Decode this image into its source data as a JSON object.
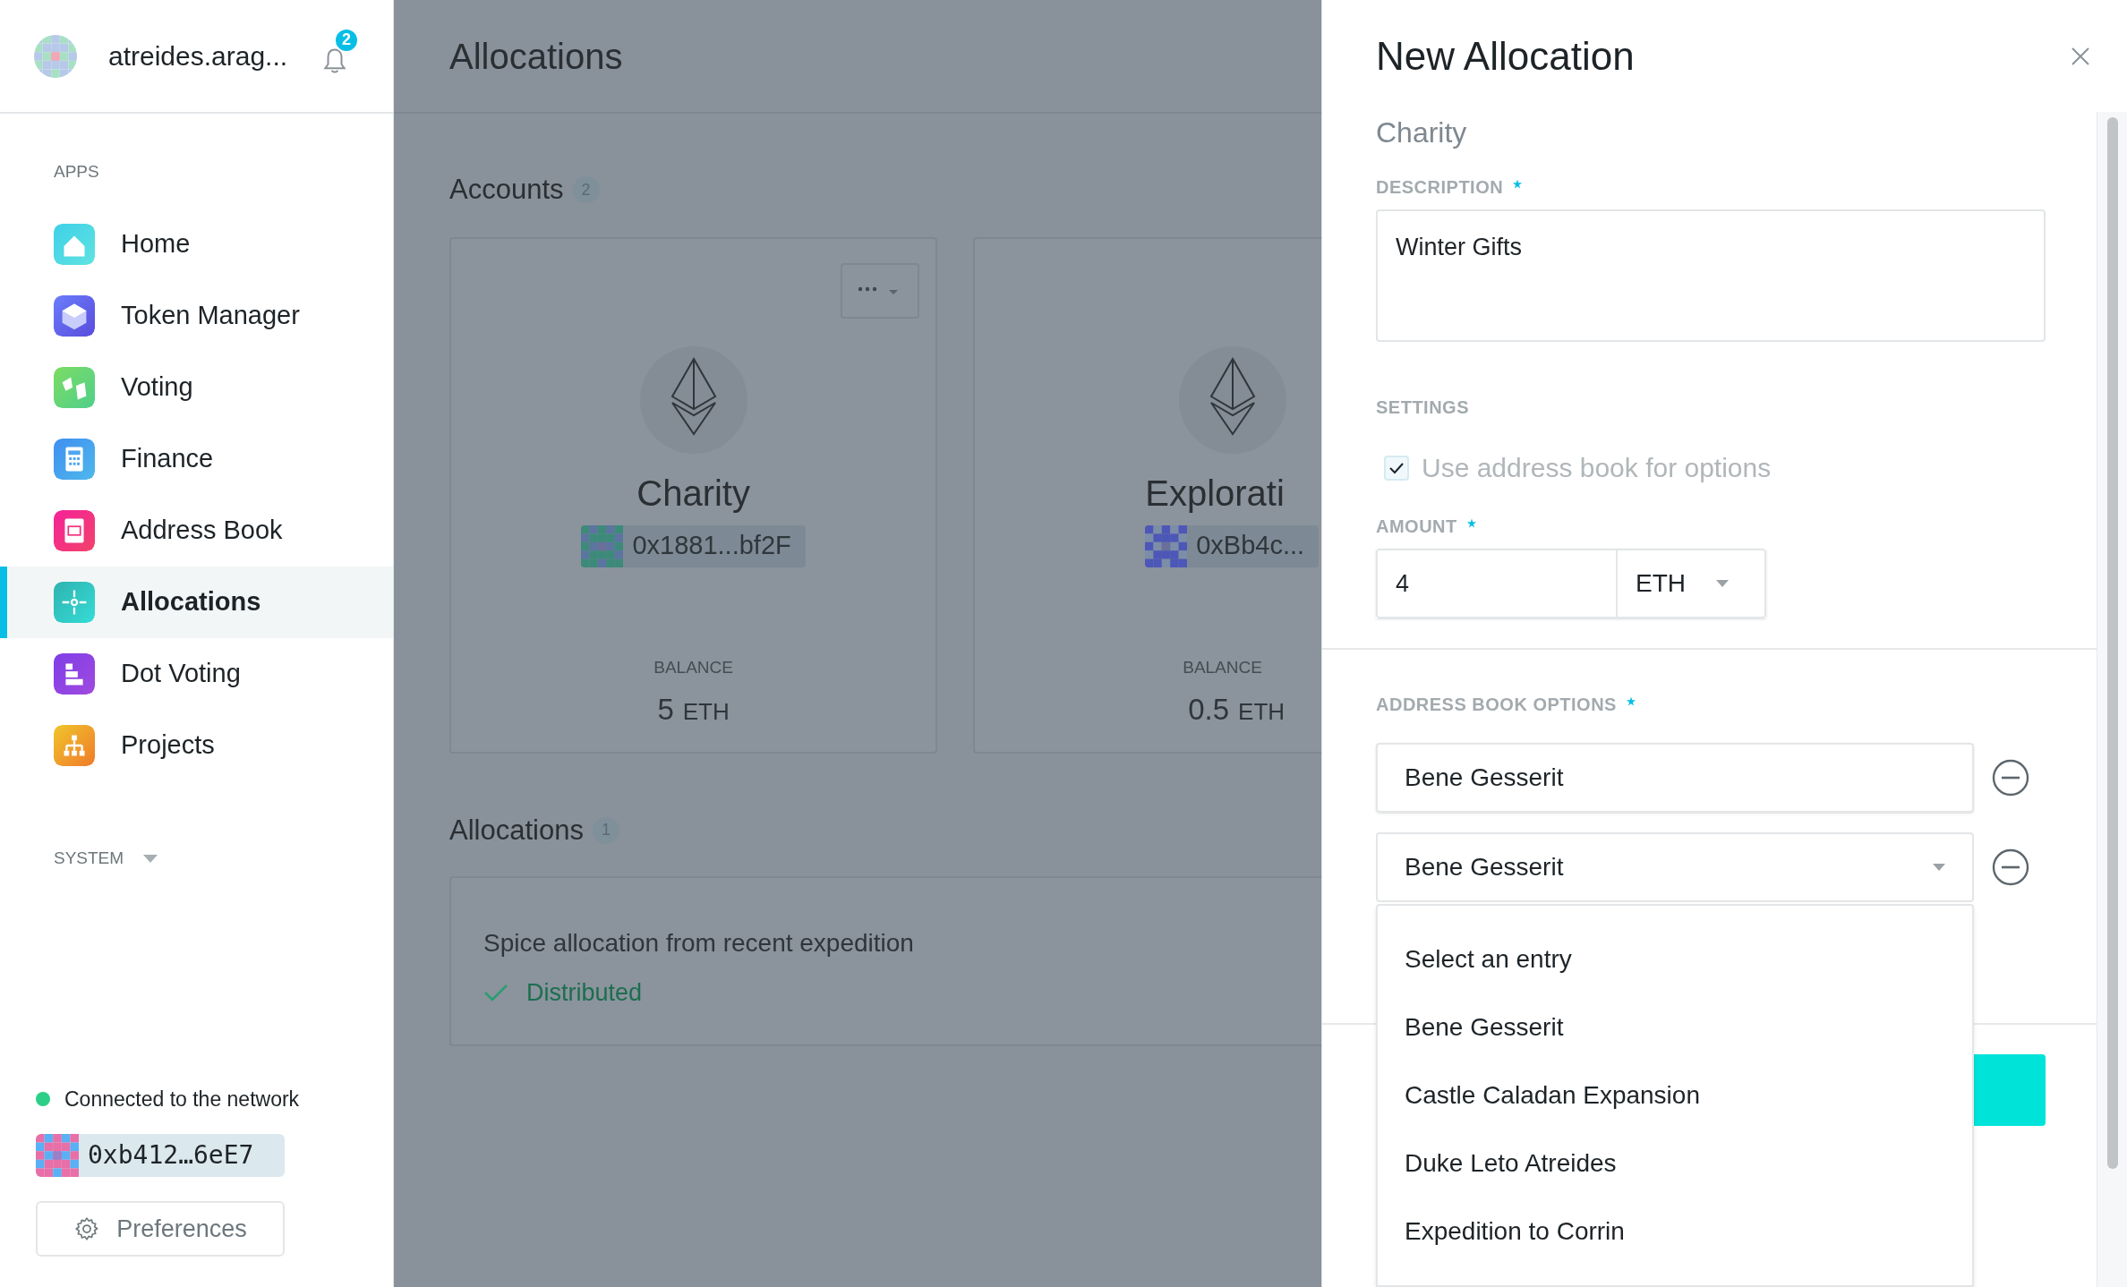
{
  "sidebar": {
    "account_name": "atreides.arag...",
    "notification_count": "2",
    "apps_heading": "APPS",
    "apps": [
      {
        "label": "Home",
        "kind": "home",
        "selected": false
      },
      {
        "label": "Token Manager",
        "kind": "token",
        "selected": false
      },
      {
        "label": "Voting",
        "kind": "voting",
        "selected": false
      },
      {
        "label": "Finance",
        "kind": "finance",
        "selected": false
      },
      {
        "label": "Address Book",
        "kind": "addressbook",
        "selected": false
      },
      {
        "label": "Allocations",
        "kind": "allocations",
        "selected": true
      },
      {
        "label": "Dot Voting",
        "kind": "dotvoting",
        "selected": false
      },
      {
        "label": "Projects",
        "kind": "projects",
        "selected": false
      }
    ],
    "system_heading": "SYSTEM",
    "network_status": "Connected to the network",
    "address": "0xb412…6eE7",
    "preferences_button": "Preferences"
  },
  "main": {
    "title": "Allocations",
    "accounts": {
      "heading": "Accounts",
      "count": "2",
      "cards": [
        {
          "name": "Charity",
          "address": "0x1881...bf2F",
          "balance_label": "BALANCE",
          "balance": "5",
          "unit": "ETH",
          "menu": true
        },
        {
          "name": "Explorati",
          "address": "0xBb4c...",
          "balance_label": "BALANCE",
          "balance": "0.5",
          "unit": "ETH",
          "menu": false
        }
      ]
    },
    "allocations": {
      "heading": "Allocations",
      "count": "1",
      "items": [
        {
          "description": "Spice allocation from recent expedition",
          "status": "Distributed"
        }
      ]
    }
  },
  "panel": {
    "title": "New Allocation",
    "subtitle": "Charity",
    "description": {
      "label": "DESCRIPTION",
      "required": true,
      "value": "Winter Gifts"
    },
    "settings": {
      "heading": "SETTINGS",
      "checkbox": {
        "label": "Use address book for options",
        "checked": true
      }
    },
    "amount": {
      "label": "AMOUNT",
      "required": true,
      "value": "4",
      "currency": "ETH"
    },
    "options": {
      "label": "ADDRESS BOOK OPTIONS",
      "required": true,
      "entries": [
        {
          "value": "Bene Gesserit",
          "kind": "text"
        },
        {
          "value": "Bene Gesserit",
          "kind": "select"
        }
      ],
      "menu": [
        "Select an entry",
        "Bene Gesserit",
        "Castle Caladan Expansion",
        "Duke Leto Atreides",
        "Expedition to Corrin"
      ]
    }
  }
}
